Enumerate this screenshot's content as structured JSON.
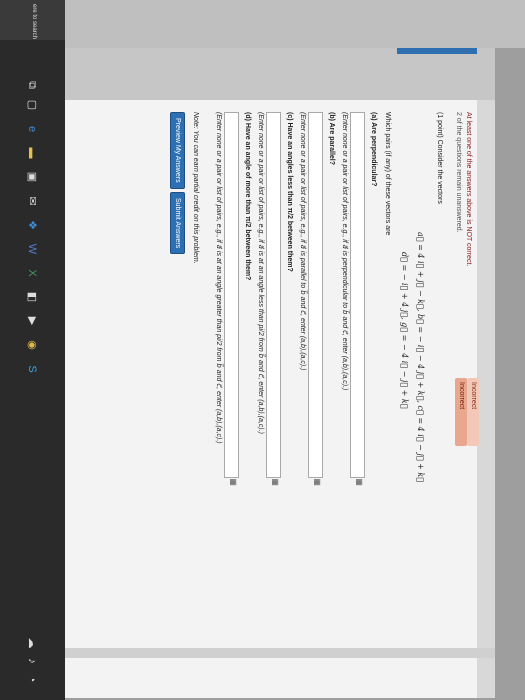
{
  "status": {
    "badge1": "Incorrect",
    "badge2": "Incorrect"
  },
  "warning": {
    "line1": "At least one of the answers above is NOT correct.",
    "line2": "2 of the questions remain unanswered."
  },
  "problem": {
    "intro": "(1 point) Consider the vectors",
    "vectors_line1": "a⃗ = 4 i⃗ + j⃗ − k⃗,   b⃗ = − i⃗ − 4 j⃗ + k⃗,   c⃗ = 4 i⃗ − j⃗ + k⃗",
    "vectors_line2": "d⃗ = − i⃗ + 4 j⃗,   g⃗ = − 4 i⃗ − j⃗ + k⃗",
    "which": "Which pairs (if any) of these vectors are",
    "a_label": "(a) Are perpendicular?",
    "a_hint": "(Enter none or a pair or list of pairs, e.g., if a⃗ is perpendicular to b⃗ and c⃗, enter (a,b),(a,c).)",
    "b_label": "(b) Are parallel?",
    "b_hint": "(Enter none or a pair or list of pairs, e.g., if a⃗ is parallel to b⃗ and c⃗, enter (a,b),(a,c).)",
    "c_label": "(c) Have an angles less than π/2 between them?",
    "c_hint": "(Enter none or a pair or list of pairs, e.g., if a⃗ is at an angle less than pi/2 from b⃗ and c⃗, enter (a,b),(a,c).)",
    "d_label": "(d) Have an angle of more than π/2 between them?",
    "d_hint": "(Enter none or a pair or list of pairs, e.g., if a⃗ is at an angle greater than pi/2 from b⃗ and c⃗, enter (a,b),(a,c).)",
    "note": "Note: You can earn partial credit on this problem.",
    "preview_btn": "Preview My Answers",
    "submit_btn": "Submit Answers"
  },
  "answers": {
    "a": "",
    "b": "",
    "c": "",
    "d": ""
  },
  "taskbar": {
    "search_text": "ere to search",
    "icons": [
      "task-view-icon",
      "edge-icon",
      "file-explorer-icon",
      "store-icon",
      "mail-icon",
      "dropbox-icon",
      "word-icon",
      "excel-icon",
      "photos-icon",
      "media-icon",
      "chrome-icon",
      "skype-icon"
    ]
  }
}
